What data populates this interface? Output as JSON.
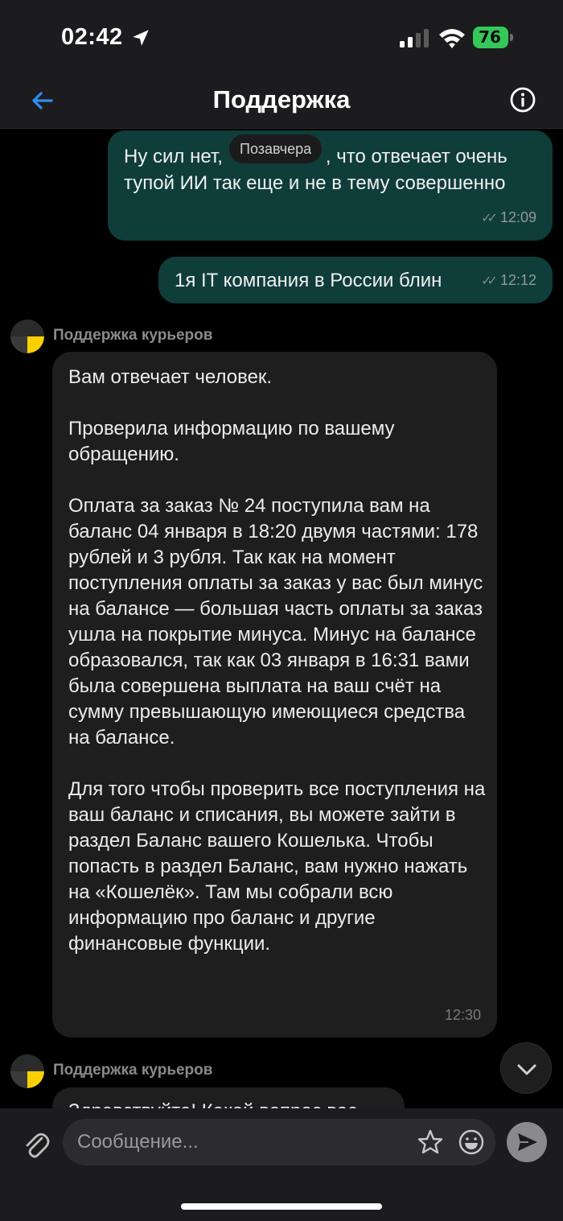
{
  "status_bar": {
    "time": "02:42",
    "battery": "76",
    "battery_color": "#34c759",
    "icons": [
      "location-arrow-icon",
      "signal-icon",
      "wifi-icon",
      "battery-charging-icon"
    ]
  },
  "header": {
    "title": "Поддержка",
    "back_icon": "arrow-left-icon",
    "info_icon": "info-circle-icon",
    "accent_color": "#2f8cf0"
  },
  "chat": {
    "date_separator": "Позавчера",
    "outgoing": [
      {
        "lines": [
          "Ну сил нет, что отвечает очень",
          "тупой ИИ так еще и не в тему совершенно"
        ],
        "line1_before": "Ну сил нет,",
        "line1_after": ", что отвечает очень",
        "line2": "тупой ИИ так еще и не в тему совершенно",
        "time": "12:09"
      },
      {
        "text": "1я IT компания в России блин",
        "time": "12:12"
      }
    ],
    "incoming": [
      {
        "sender": "Поддержка курьеров",
        "paragraphs": [
          "Вам отвечает человек.",
          "Проверила информацию по вашему обращению.",
          "Оплата за заказ № 24 поступила вам на баланс 04 января в 18:20 двумя частями: 178 рублей и 3 рубля. Так как на момент поступления оплаты за заказ у вас был минус на балансе — большая часть оплаты за заказ ушла на покрытие минуса. Минус на балансе образовался, так как 03 января в 16:31 вами была совершена выплата на ваш счёт на сумму превышающую имеющиеся средства на балансе.",
          "Для того чтобы проверить все поступления на ваш баланс и списания, вы можете зайти в раздел Баланс вашего Кошелька. Чтобы попасть в раздел Баланс, вам нужно нажать на «Кошелёк». Там мы собрали всю информацию про баланс и другие финансовые функции."
        ],
        "time": "12:30"
      },
      {
        "sender": "Поддержка курьеров",
        "text": "Здравствуйте! Какой вопрос вас"
      }
    ],
    "bubble_out_color": "#0f3d3a",
    "bubble_in_color": "#1e1e1e"
  },
  "composer": {
    "placeholder": "Сообщение...",
    "icons": [
      "paperclip-icon",
      "star-icon",
      "emoji-icon",
      "send-icon",
      "chevron-down-icon"
    ]
  }
}
